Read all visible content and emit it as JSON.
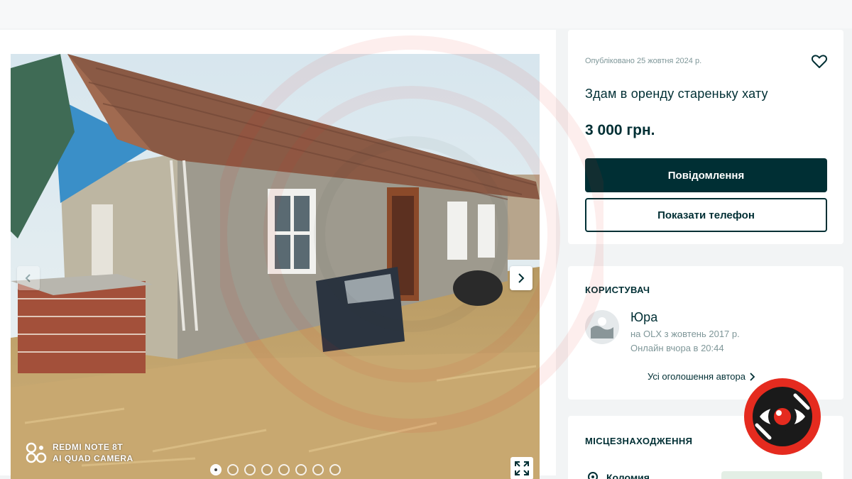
{
  "ad": {
    "published": "Опубліковано 25 жовтня 2024 р.",
    "title": "Здам в оренду стареньку хату",
    "price": "3 000 грн.",
    "message_button": "Повідомлення",
    "phone_button": "Показати телефон"
  },
  "gallery": {
    "camera_line1": "REDMI NOTE 8T",
    "camera_line2": "AI QUAD CAMERA",
    "photo_count": 8,
    "active_photo": 1
  },
  "user": {
    "heading": "КОРИСТУВАЧ",
    "name": "Юра",
    "since": "на OLX з жовтень 2017 р.",
    "online": "Онлайн вчора в 20:44",
    "all_ads": "Усі оголошення автора"
  },
  "location": {
    "heading": "МІСЦЕЗНАХОДЖЕННЯ",
    "city": "Коломия"
  },
  "colors": {
    "brand_dark": "#002f34",
    "muted_text": "#7f9799",
    "logo_red": "#e52b1f"
  }
}
